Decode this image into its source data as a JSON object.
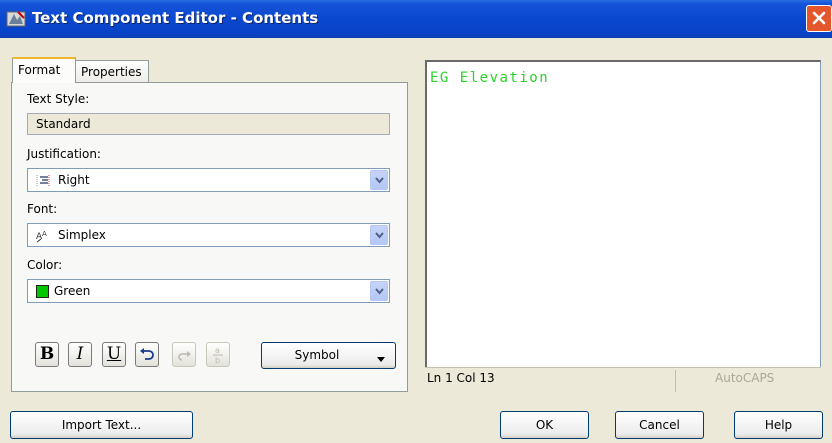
{
  "window": {
    "title": "Text Component Editor - Contents"
  },
  "tabs": [
    {
      "label": "Format",
      "selected": true
    },
    {
      "label": "Properties",
      "selected": false
    }
  ],
  "format": {
    "text_style": {
      "label": "Text Style:",
      "value": "Standard"
    },
    "justification": {
      "label": "Justification:",
      "value": "Right",
      "icon": "justify-right-icon"
    },
    "font": {
      "label": "Font:",
      "value": "Simplex",
      "icon": "font-icon"
    },
    "color": {
      "label": "Color:",
      "value": "Green",
      "swatch": "#00c800"
    },
    "buttons": {
      "bold": "B",
      "italic": "I",
      "underline": "U",
      "undo_icon": "undo-icon",
      "redo_icon": "redo-icon",
      "stack_icon": "stack-fraction-icon"
    },
    "symbol_label": "Symbol"
  },
  "editor": {
    "content": "EG Elevation",
    "text_color": "#2bd32b"
  },
  "status": {
    "position": "Ln 1 Col 13",
    "caps": "AutoCAPS"
  },
  "dialog_buttons": {
    "import": "Import Text...",
    "ok": "OK",
    "cancel": "Cancel",
    "help": "Help"
  }
}
